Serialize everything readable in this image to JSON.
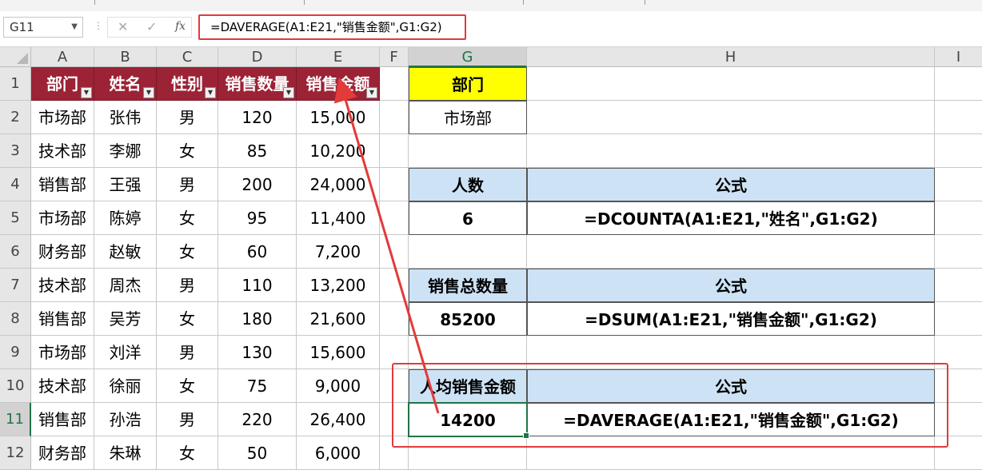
{
  "name_box": "G11",
  "formula_bar": {
    "cancel_glyph": "✕",
    "enter_glyph": "✓",
    "fx_glyph": "fx",
    "formula": "=DAVERAGE(A1:E21,\"销售金额\",G1:G2)"
  },
  "columns": [
    "A",
    "B",
    "C",
    "D",
    "E",
    "F",
    "G",
    "H",
    "I"
  ],
  "rows": [
    "1",
    "2",
    "3",
    "4",
    "5",
    "6",
    "7",
    "8",
    "9",
    "10",
    "11",
    "12"
  ],
  "selected": {
    "column": "G",
    "row": "11"
  },
  "table": {
    "headers": [
      "部门",
      "姓名",
      "性别",
      "销售数量",
      "销售金额"
    ],
    "rows": [
      [
        "市场部",
        "张伟",
        "男",
        "120",
        "15,000"
      ],
      [
        "技术部",
        "李娜",
        "女",
        "85",
        "10,200"
      ],
      [
        "销售部",
        "王强",
        "男",
        "200",
        "24,000"
      ],
      [
        "市场部",
        "陈婷",
        "女",
        "95",
        "11,400"
      ],
      [
        "财务部",
        "赵敏",
        "女",
        "60",
        "7,200"
      ],
      [
        "技术部",
        "周杰",
        "男",
        "110",
        "13,200"
      ],
      [
        "销售部",
        "吴芳",
        "女",
        "180",
        "21,600"
      ],
      [
        "市场部",
        "刘洋",
        "男",
        "130",
        "15,600"
      ],
      [
        "技术部",
        "徐丽",
        "女",
        "75",
        "9,000"
      ],
      [
        "销售部",
        "孙浩",
        "男",
        "220",
        "26,400"
      ],
      [
        "财务部",
        "朱琳",
        "女",
        "50",
        "6,000"
      ]
    ]
  },
  "criteria": {
    "header": "部门",
    "value": "市场部"
  },
  "blocks": [
    {
      "label": "人数",
      "formula_header": "公式",
      "value": "6",
      "formula": "=DCOUNTA(A1:E21,\"姓名\",G1:G2)"
    },
    {
      "label": "销售总数量",
      "formula_header": "公式",
      "value": "85200",
      "formula": "=DSUM(A1:E21,\"销售金额\",G1:G2)"
    },
    {
      "label": "人均销售金额",
      "formula_header": "公式",
      "value": "14200",
      "formula": "=DAVERAGE(A1:E21,\"销售金额\",G1:G2)"
    }
  ],
  "colors": {
    "header_fill": "#9b2335",
    "criteria_fill": "#ffff00",
    "block_header_fill": "#cde3f5",
    "highlight": "#e33a3a",
    "excel_green": "#217346"
  }
}
